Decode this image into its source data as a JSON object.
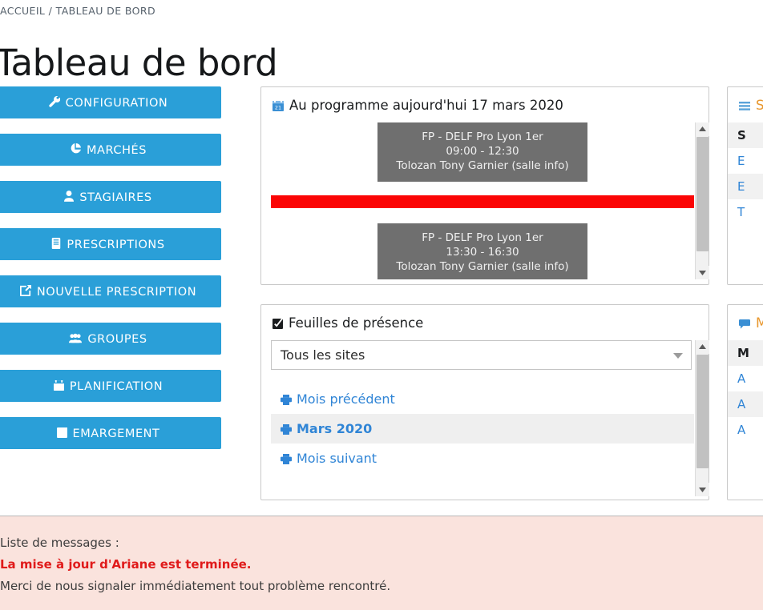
{
  "breadcrumb": "ACCUEIL / TABLEAU DE BORD",
  "page_title": "Tableau de bord",
  "colors": {
    "sidebar_button": "#2a9fd8",
    "event_card": "#6f6f6f",
    "now_bar": "#fb0505",
    "link_blue": "#3085d6",
    "alert_bg": "#fae3dd",
    "alert_text_red": "#e01b1b"
  },
  "sidebar": {
    "items": [
      {
        "label": "CONFIGURATION",
        "icon": "wrench-icon"
      },
      {
        "label": "MARCHÉS",
        "icon": "pie-chart-icon"
      },
      {
        "label": "STAGIAIRES",
        "icon": "user-icon"
      },
      {
        "label": "PRESCRIPTIONS",
        "icon": "document-icon"
      },
      {
        "label": "NOUVELLE PRESCRIPTION",
        "icon": "edit-document-icon"
      },
      {
        "label": "GROUPES",
        "icon": "users-icon"
      },
      {
        "label": "PLANIFICATION",
        "icon": "calendar-icon"
      },
      {
        "label": "EMARGEMENT",
        "icon": "checkbox-icon"
      }
    ]
  },
  "agenda": {
    "title": "Au programme aujourd'hui 17 mars 2020",
    "icon": "calendar-icon",
    "events": [
      {
        "title": "FP - DELF Pro Lyon 1er",
        "time": "09:00 - 12:30",
        "location": "Tolozan Tony Garnier (salle info)"
      },
      {
        "title": "FP - DELF Pro Lyon 1er",
        "time": "13:30 - 16:30",
        "location": "Tolozan Tony Garnier (salle info)"
      }
    ],
    "now_indicator": true
  },
  "presence": {
    "title": "Feuilles de présence",
    "icon": "checkbox-icon",
    "site_select": {
      "value": "Tous les sites",
      "options": [
        "Tous les sites"
      ]
    },
    "months": [
      {
        "label": "Mois précédent",
        "icon": "printer-icon",
        "current": false
      },
      {
        "label": "Mars 2020",
        "icon": "printer-icon",
        "current": true
      },
      {
        "label": "Mois suivant",
        "icon": "printer-icon",
        "current": false
      }
    ]
  },
  "right_panel_top": {
    "icon": "list-icon",
    "title": "Sessions",
    "rows": [
      "S",
      "E",
      "E",
      "T"
    ]
  },
  "right_panel_bottom": {
    "icon": "comment-icon",
    "title": "Messages",
    "rows": [
      "M",
      "A",
      "A",
      "A"
    ]
  },
  "alert": {
    "line1": "Liste de messages :",
    "line2": "La mise à jour d'Ariane est terminée.",
    "line3": "Merci de nous signaler immédiatement tout problème rencontré."
  }
}
